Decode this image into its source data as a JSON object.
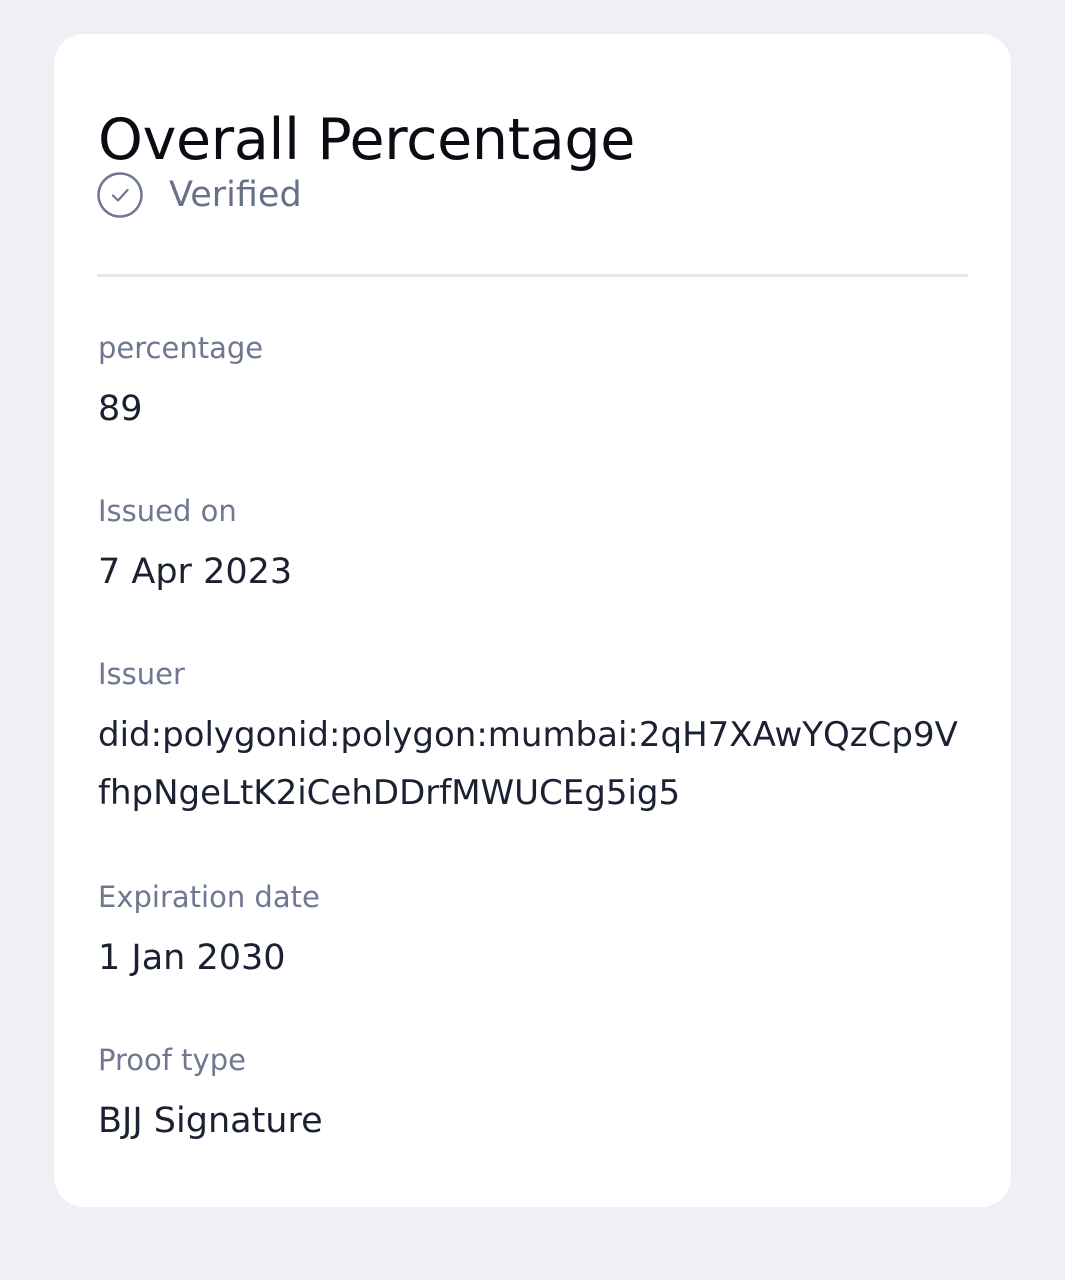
{
  "card": {
    "title": "Overall Percentage",
    "status": {
      "label": "Verified",
      "icon": "check-circle-icon"
    }
  },
  "fields": {
    "percentage": {
      "label": "percentage",
      "value": "89"
    },
    "issued_on": {
      "label": "Issued on",
      "value": "7 Apr 2023"
    },
    "issuer": {
      "label": "Issuer",
      "value": "did:polygonid:polygon:mumbai:2qH7XAwYQzCp9VfhpNgeLtK2iCehDDrfMWUCEg5ig5"
    },
    "expiration_date": {
      "label": "Expiration date",
      "value": "1 Jan 2030"
    },
    "proof_type": {
      "label": "Proof type",
      "value": "BJJ Signature"
    }
  },
  "colors": {
    "background": "#eff0f5",
    "card": "#ffffff",
    "title": "#0b0b14",
    "muted": "#6f7890",
    "value": "#1b2133"
  }
}
